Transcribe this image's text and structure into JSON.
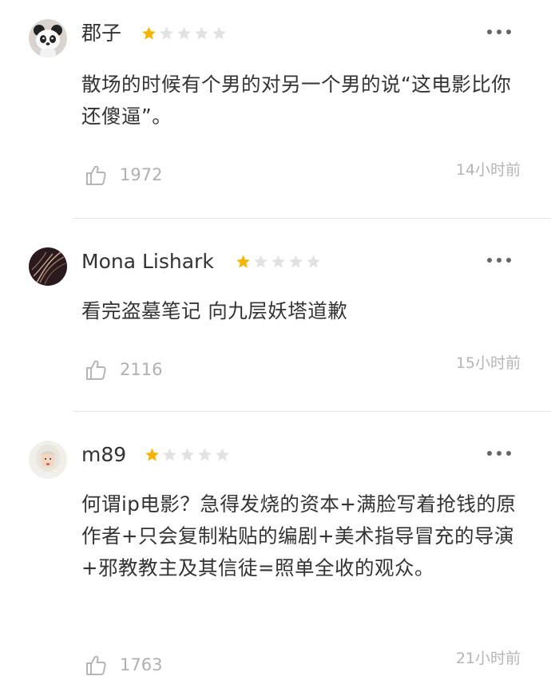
{
  "comments": [
    {
      "name": "郡子",
      "rating": 1,
      "max_rating": 5,
      "text": "散场的时候有个男的对另一个男的说“这电影比你还傻逼”。",
      "likes": "1972",
      "time": "14小时前",
      "avatar_icon": "panda-avatar"
    },
    {
      "name": "Mona Lishark",
      "rating": 1,
      "max_rating": 5,
      "text": "看完盗墓笔记 向九层妖塔道歉",
      "likes": "2116",
      "time": "15小时前",
      "avatar_icon": "dark-feather-avatar"
    },
    {
      "name": "m89",
      "rating": 1,
      "max_rating": 5,
      "text": "何谓ip电影？急得发烧的资本+满脸写着抢钱的原作者+只会复制粘贴的编剧+美术指导冒充的导演+邪教教主及其信徒=照单全收的观众。",
      "likes": "1763",
      "time": "21小时前",
      "avatar_icon": "portrait-avatar"
    }
  ],
  "colors": {
    "star_active": "#f5b400",
    "star_inactive": "#e2e2e2",
    "meta_text": "#b0b0b0",
    "divider": "#e4e4e4"
  }
}
